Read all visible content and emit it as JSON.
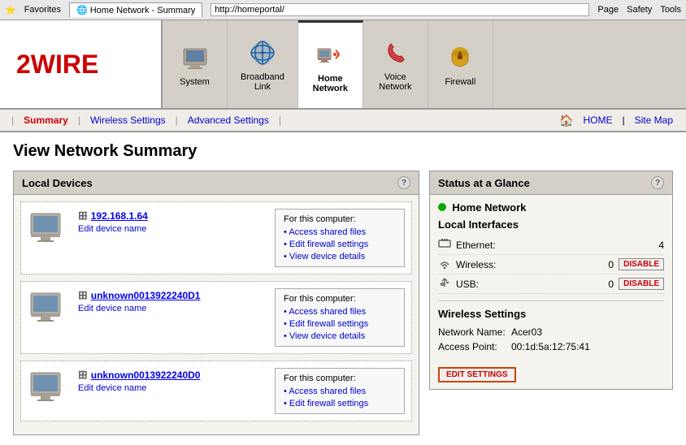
{
  "browser": {
    "tab_label": "Home Network - Summary",
    "favorites_label": "Favorites",
    "page_label": "Page",
    "safety_label": "Safety",
    "tools_label": "Tools"
  },
  "header": {
    "logo": "2WIRE",
    "nav_items": [
      {
        "id": "system",
        "label": "System",
        "icon": "system"
      },
      {
        "id": "broadband",
        "label": "Broadband\nLink",
        "icon": "broadband"
      },
      {
        "id": "home-network",
        "label": "Home\nNetwork",
        "icon": "home-network",
        "active": true
      },
      {
        "id": "voice-network",
        "label": "Voice\nNetwork",
        "icon": "voice"
      },
      {
        "id": "firewall",
        "label": "Firewall",
        "icon": "firewall"
      }
    ]
  },
  "subnav": {
    "items": [
      {
        "id": "summary",
        "label": "Summary",
        "active": true
      },
      {
        "id": "wireless-settings",
        "label": "Wireless Settings",
        "active": false
      },
      {
        "id": "advanced-settings",
        "label": "Advanced Settings",
        "active": false
      }
    ],
    "home_label": "HOME",
    "sitemap_label": "Site Map"
  },
  "page": {
    "title": "View Network Summary"
  },
  "local_devices": {
    "panel_title": "Local Devices",
    "devices": [
      {
        "id": "dev1",
        "ip": "192.168.1.64",
        "edit_label": "Edit device name",
        "for_label": "For this computer:",
        "links": [
          {
            "id": "shared",
            "label": "Access shared files"
          },
          {
            "id": "firewall",
            "label": "Edit firewall settings"
          },
          {
            "id": "details",
            "label": "View device details"
          }
        ]
      },
      {
        "id": "dev2",
        "ip": "unknown0013922240D1",
        "edit_label": "Edit device name",
        "for_label": "For this computer:",
        "links": [
          {
            "id": "shared",
            "label": "Access shared files"
          },
          {
            "id": "firewall",
            "label": "Edit firewall settings"
          },
          {
            "id": "details",
            "label": "View device details"
          }
        ]
      },
      {
        "id": "dev3",
        "ip": "unknown0013922240D0",
        "edit_label": "Edit device name",
        "for_label": "For this computer:",
        "links": [
          {
            "id": "shared",
            "label": "Access shared files"
          },
          {
            "id": "firewall",
            "label": "Edit firewall settings"
          }
        ]
      }
    ]
  },
  "status_glance": {
    "panel_title": "Status at a Glance",
    "network_label": "Home Network",
    "local_interfaces_label": "Local Interfaces",
    "interfaces": [
      {
        "id": "ethernet",
        "label": "Ethernet:",
        "value": "4",
        "has_button": false
      },
      {
        "id": "wireless",
        "label": "Wireless:",
        "value": "0",
        "has_button": true,
        "button_label": "DISABLE"
      },
      {
        "id": "usb",
        "label": "USB:",
        "value": "0",
        "has_button": true,
        "button_label": "DISABLE"
      }
    ],
    "wireless_settings_label": "Wireless Settings",
    "network_name_label": "Network Name:",
    "network_name_value": "Acer03",
    "access_point_label": "Access Point:",
    "access_point_value": "00:1d:5a:12:75:41",
    "edit_button_label": "EDIT SETTINGS"
  }
}
